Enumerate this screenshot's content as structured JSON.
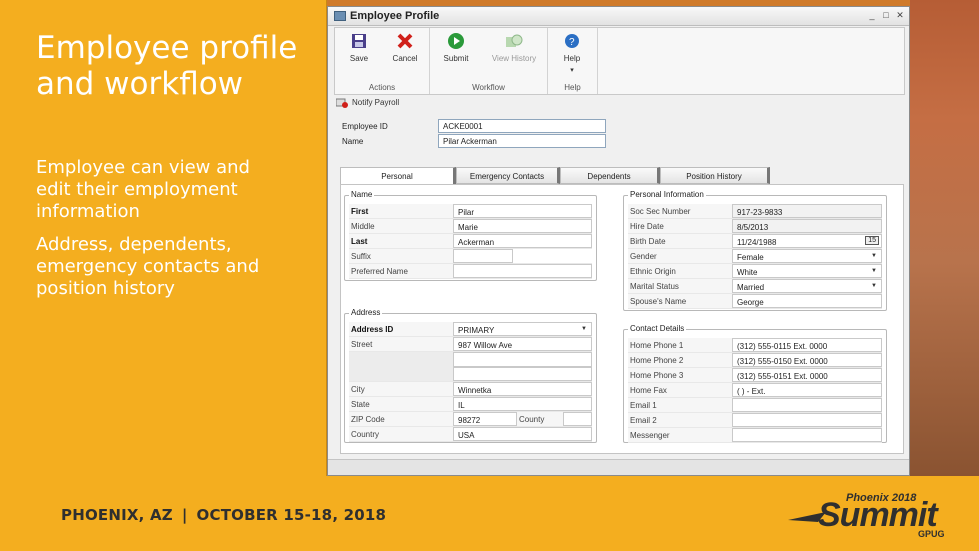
{
  "slide": {
    "title": "Employee profile and workflow",
    "bullet1": "Employee can view and edit their employment information",
    "bullet2": "Address, dependents, emergency contacts and position history",
    "footer_location": "PHOENIX, AZ",
    "footer_sep": "|",
    "footer_dates": "OCTOBER 15-18, 2018",
    "logo_small": "Phoenix 2018",
    "logo_main": "Summit",
    "logo_sub": "GPUG"
  },
  "window": {
    "title": "Employee Profile",
    "controls": [
      "_",
      "□",
      "✕"
    ]
  },
  "ribbon": {
    "groups": [
      {
        "label": "Actions"
      },
      {
        "label": "Workflow"
      },
      {
        "label": "Help"
      }
    ],
    "save": "Save",
    "cancel": "Cancel",
    "submit": "Submit",
    "view_history": "View History",
    "help": "Help",
    "help_more": "▾"
  },
  "notify": "Notify Payroll",
  "employee": {
    "id_label": "Employee ID",
    "id_value": "ACKE0001",
    "name_label": "Name",
    "name_value": "Pilar Ackerman"
  },
  "tabs": [
    "Personal",
    "Emergency Contacts",
    "Dependents",
    "Position History"
  ],
  "name_section": {
    "legend": "Name",
    "rows": [
      {
        "label": "First",
        "value": "Pilar"
      },
      {
        "label": "Middle",
        "value": "Marie"
      },
      {
        "label": "Last",
        "value": "Ackerman"
      },
      {
        "label": "Suffix",
        "value": ""
      },
      {
        "label": "Preferred Name",
        "value": ""
      }
    ]
  },
  "personal_section": {
    "legend": "Personal Information",
    "rows": [
      {
        "label": "Soc Sec Number",
        "value": "917-23-9833"
      },
      {
        "label": "Hire Date",
        "value": "8/5/2013"
      },
      {
        "label": "Birth Date",
        "value": "11/24/1988"
      },
      {
        "label": "Gender",
        "value": "Female"
      },
      {
        "label": "Ethnic Origin",
        "value": "White"
      },
      {
        "label": "Marital Status",
        "value": "Married"
      },
      {
        "label": "Spouse's Name",
        "value": "George"
      }
    ],
    "calendar_icon": "15"
  },
  "address_section": {
    "legend": "Address",
    "rows": [
      {
        "label": "Address ID",
        "value": "PRIMARY"
      },
      {
        "label": "Street",
        "value": "987 Willow Ave"
      },
      {
        "label": "",
        "value": ""
      },
      {
        "label": "City",
        "value": "Winnetka"
      },
      {
        "label": "State",
        "value": "IL"
      },
      {
        "label": "ZIP Code",
        "value": "98272"
      },
      {
        "label": "Country",
        "value": "USA"
      }
    ],
    "county_label": "County"
  },
  "contact_section": {
    "legend": "Contact Details",
    "rows": [
      {
        "label": "Home Phone 1",
        "value": "(312) 555-0115  Ext. 0000"
      },
      {
        "label": "Home Phone 2",
        "value": "(312) 555-0150  Ext. 0000"
      },
      {
        "label": "Home Phone 3",
        "value": "(312) 555-0151  Ext. 0000"
      },
      {
        "label": "Home Fax",
        "value": "(   )   -      Ext."
      },
      {
        "label": "Email 1",
        "value": ""
      },
      {
        "label": "Email 2",
        "value": ""
      },
      {
        "label": "Messenger",
        "value": ""
      }
    ]
  }
}
